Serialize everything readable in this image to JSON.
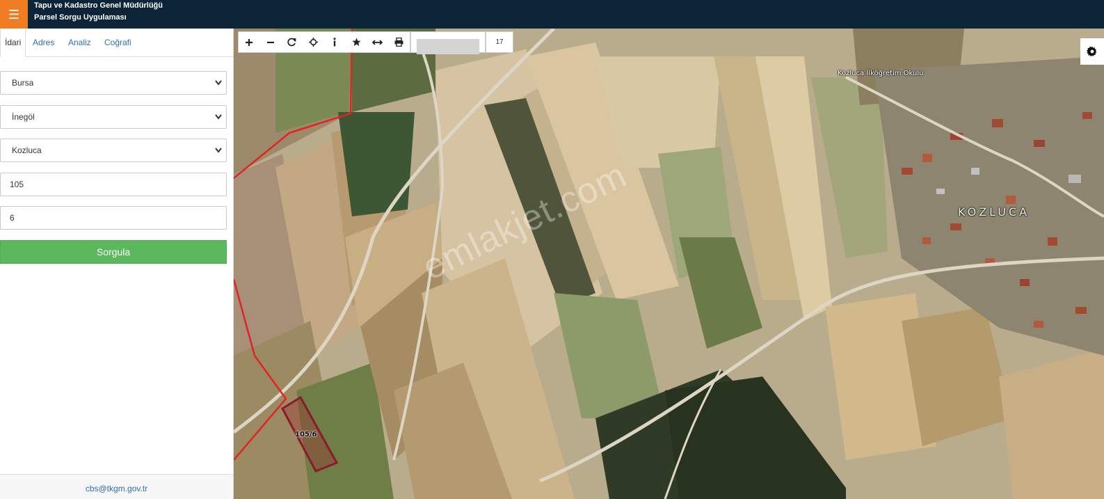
{
  "header": {
    "menu_icon": "menu-icon",
    "title_line1": "Tapu ve Kadastro Genel Müdürlüğü",
    "title_line2": "Parsel Sorgu Uygulaması"
  },
  "sidebar": {
    "tabs": [
      {
        "label": "İdari",
        "active": true
      },
      {
        "label": "Adres",
        "active": false
      },
      {
        "label": "Analiz",
        "active": false
      },
      {
        "label": "Coğrafi",
        "active": false
      }
    ],
    "province": "Bursa",
    "district": "İnegöl",
    "neighborhood": "Kozluca",
    "block_no": "105",
    "parcel_no": "6",
    "submit_label": "Sorgula",
    "footer_email": "cbs@tkgm.gov.tr"
  },
  "map": {
    "toolbar_icons": [
      "zoom-in-icon",
      "zoom-out-icon",
      "refresh-icon",
      "locate-icon",
      "info-icon",
      "star-icon",
      "measure-icon",
      "print-icon"
    ],
    "zoom_level": "17",
    "settings_icon": "gear-icon",
    "labels": {
      "school": "Kozluca İlköğretim Okulu",
      "village": "KOZLUCA",
      "parcel": "105/6"
    },
    "watermark": "emlakjet.com",
    "colors": {
      "boundary_red": "#e02424",
      "parcel_outline": "#8b1a2a",
      "header_bg": "#0b2438",
      "menu_orange": "#f07c24",
      "submit_green": "#5cb85c",
      "link_blue": "#2a6fb0"
    }
  }
}
